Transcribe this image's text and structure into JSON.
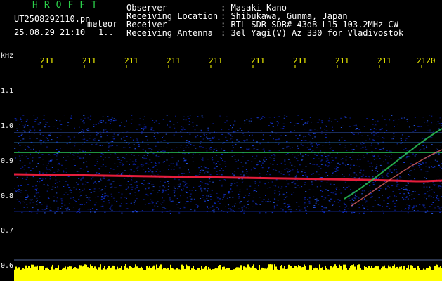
{
  "header": {
    "brand": "HROFFT",
    "file_name": "UT2508292110.pn",
    "file_type": "meteor",
    "date_time": "25.08.29 21:10",
    "frame_index": "1..",
    "observer_label": "Observer",
    "observer_value": ": Masaki Kano",
    "location_label": "Receiving Location",
    "location_value": ": Shibukawa, Gunma, Japan",
    "receiver_label": "Receiver",
    "receiver_value": ": RTL-SDR SDR# 43dB L15 103.2MHz CW",
    "antenna_label": "Receiving Antenna",
    "antenna_value": ": 3el Yagi(V) Az 330 for Vladivostok"
  },
  "axis": {
    "unit": "kHz",
    "y_ticks": [
      "1.1",
      "1.0",
      "0.9",
      "0.8",
      "0.7",
      "0.6"
    ],
    "x_ticks": [
      "211",
      "211",
      "211",
      "211",
      "211",
      "211",
      "211",
      "211",
      "211",
      "2120"
    ]
  },
  "colors": {
    "background": "#000000",
    "noise": "#0a2fd6",
    "signal_green": "#2dd15a",
    "signal_red": "#ff2040",
    "amplitude": "#ffff00",
    "tick": "#ffff00"
  }
}
